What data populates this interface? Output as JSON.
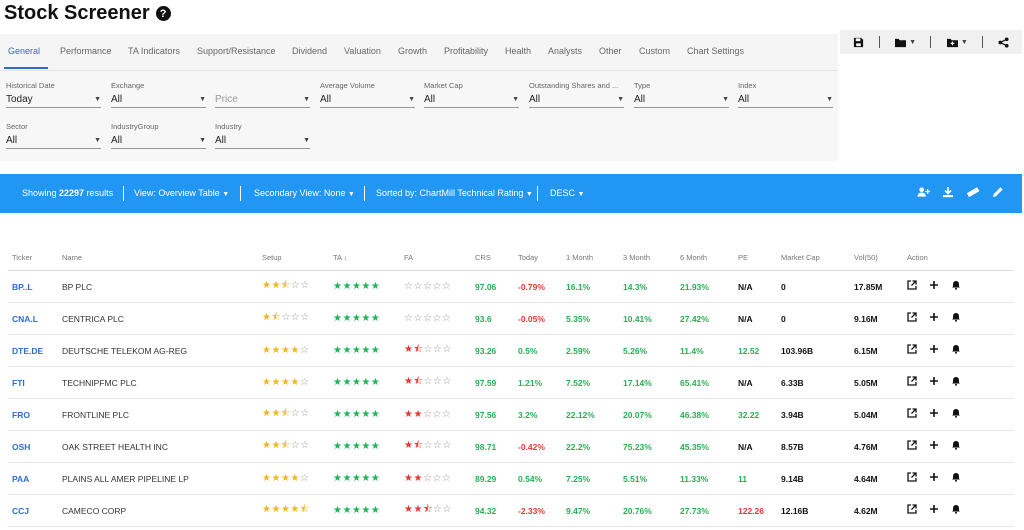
{
  "page": {
    "title": "Stock Screener",
    "help": "?"
  },
  "tabs": [
    "General",
    "Performance",
    "TA Indicators",
    "Support/Resistance",
    "Dividend",
    "Valuation",
    "Growth",
    "Profitability",
    "Health",
    "Analysts",
    "Other",
    "Custom",
    "Chart Settings"
  ],
  "toolbar": {
    "save": "save-icon",
    "folder": "folder-icon",
    "folder_add": "folder-plus-icon",
    "share": "share-icon"
  },
  "filters": [
    {
      "label": "Historical Date",
      "value": "Today"
    },
    {
      "label": "Exchange",
      "value": "All"
    },
    {
      "label": "",
      "value": "Price"
    },
    {
      "label": "Average Volume",
      "value": "All"
    },
    {
      "label": "Market Cap",
      "value": "All"
    },
    {
      "label": "Outstanding Shares and ...",
      "value": "All"
    },
    {
      "label": "Type",
      "value": "All"
    },
    {
      "label": "Index",
      "value": "All"
    },
    {
      "label": "Sector",
      "value": "All"
    },
    {
      "label": "IndustryGroup",
      "value": "All"
    },
    {
      "label": "Industry",
      "value": "All"
    }
  ],
  "bar": {
    "showing_prefix": "Showing ",
    "showing_count": "22297",
    "showing_suffix": " results",
    "view": "View: Overview Table",
    "secondary": "Secondary View: None",
    "sorted": "Sorted by: ChartMill Technical Rating",
    "order": "DESC"
  },
  "columns": [
    "Ticker",
    "Name",
    "Setup",
    "TA",
    "FA",
    "CRS",
    "Today",
    "1 Month",
    "3 Month",
    "6 Month",
    "PE",
    "Market Cap",
    "Vol(50)",
    "Action"
  ],
  "ta_sort_arrow": "↓",
  "rows": [
    {
      "ticker": "BP..L",
      "name": "BP PLC",
      "setup": 2.5,
      "ta": 5,
      "fa": 0,
      "crs": "97.06",
      "today": "-0.79%",
      "m1": "16.1%",
      "m3": "14.3%",
      "m6": "21.93%",
      "pe": "N/A",
      "mcap": "0",
      "vol": "17.85M"
    },
    {
      "ticker": "CNA.L",
      "name": "CENTRICA PLC",
      "setup": 1.5,
      "ta": 5,
      "fa": 0,
      "crs": "93.6",
      "today": "-0.05%",
      "m1": "5.35%",
      "m3": "10.41%",
      "m6": "27.42%",
      "pe": "N/A",
      "mcap": "0",
      "vol": "9.16M"
    },
    {
      "ticker": "DTE.DE",
      "name": "DEUTSCHE TELEKOM AG-REG",
      "setup": 4,
      "ta": 5,
      "fa": 1.5,
      "crs": "93.26",
      "today": "0.5%",
      "m1": "2.59%",
      "m3": "5.26%",
      "m6": "11.4%",
      "pe": "12.52",
      "mcap": "103.96B",
      "vol": "6.15M"
    },
    {
      "ticker": "FTI",
      "name": "TECHNIPFMC PLC",
      "setup": 4,
      "ta": 5,
      "fa": 1.5,
      "crs": "97.59",
      "today": "1.21%",
      "m1": "7.52%",
      "m3": "17.14%",
      "m6": "65.41%",
      "pe": "N/A",
      "mcap": "6.33B",
      "vol": "5.05M"
    },
    {
      "ticker": "FRO",
      "name": "FRONTLINE PLC",
      "setup": 2.5,
      "ta": 5,
      "fa": 2,
      "crs": "97.56",
      "today": "3.2%",
      "m1": "22.12%",
      "m3": "20.07%",
      "m6": "46.38%",
      "pe": "32.22",
      "mcap": "3.94B",
      "vol": "5.04M"
    },
    {
      "ticker": "OSH",
      "name": "OAK STREET HEALTH INC",
      "setup": 2.5,
      "ta": 5,
      "fa": 1.5,
      "crs": "98.71",
      "today": "-0.42%",
      "m1": "22.2%",
      "m3": "75.23%",
      "m6": "45.35%",
      "pe": "N/A",
      "mcap": "8.57B",
      "vol": "4.76M"
    },
    {
      "ticker": "PAA",
      "name": "PLAINS ALL AMER PIPELINE LP",
      "setup": 4,
      "ta": 5,
      "fa": 2,
      "crs": "89.29",
      "today": "0.54%",
      "m1": "7.25%",
      "m3": "5.51%",
      "m6": "11.33%",
      "pe": "11",
      "mcap": "9.14B",
      "vol": "4.64M"
    },
    {
      "ticker": "CCJ",
      "name": "CAMECO CORP",
      "setup": 4.5,
      "ta": 5,
      "fa": 2.5,
      "crs": "94.32",
      "today": "-2.33%",
      "m1": "9.47%",
      "m3": "20.76%",
      "m6": "27.73%",
      "pe": "122.26",
      "mcap": "12.16B",
      "vol": "4.62M"
    }
  ],
  "colors": {
    "accent": "#2196f3",
    "link": "#2f6cd1",
    "positive": "#2aae56",
    "negative": "#e53935",
    "star_setup": "#f5b623",
    "star_ta": "#1fb35a",
    "star_fa": "#e53935"
  }
}
